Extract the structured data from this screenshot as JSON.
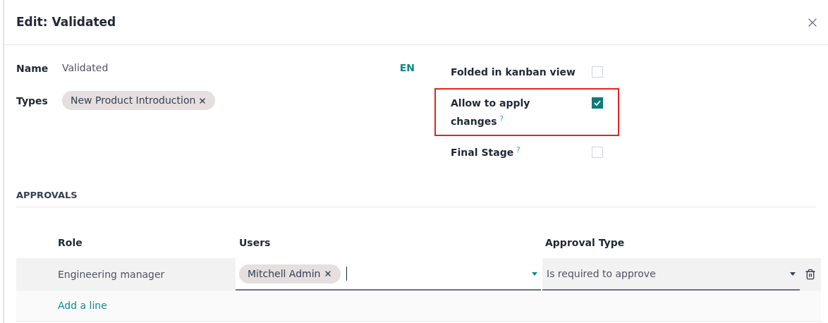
{
  "dialog": {
    "title": "Edit: Validated"
  },
  "fields": [
    {
      "label": "Name",
      "value": "Validated",
      "lang": "EN"
    },
    {
      "label": "Types",
      "tags": [
        "New Product Introduction"
      ]
    }
  ],
  "options": [
    {
      "label": "Folded in kanban view",
      "checked": false,
      "highlighted": false
    },
    {
      "label": "Allow to apply changes",
      "help": "?",
      "checked": true,
      "highlighted": true
    },
    {
      "label": "Final Stage",
      "help": "?",
      "checked": false,
      "highlighted": false
    }
  ],
  "approvals": {
    "title": "APPROVALS",
    "columns": [
      "Role",
      "Users",
      "Approval Type"
    ],
    "rows": [
      {
        "role": "Engineering manager",
        "users": [
          "Mitchell Admin"
        ],
        "approval_type": "Is required to approve",
        "editing": true
      }
    ],
    "add_line": "Add a line"
  }
}
